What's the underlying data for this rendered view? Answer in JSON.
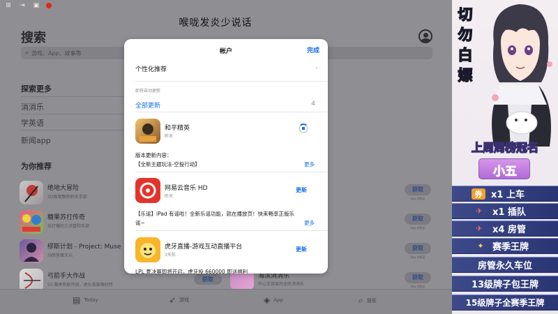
{
  "stream_title": "喉咙发炎少说话",
  "search_screen": {
    "title": "搜索",
    "search_placeholder": "游戏、App、故事等",
    "explore_heading": "探索更多",
    "explore_items": [
      "消消乐",
      "学英语",
      "新闻app"
    ],
    "recommend_heading": "为你推荐",
    "apps": [
      {
        "name": "绝地大冒险",
        "sub": "3D极限飘移射击手游",
        "button": "获取",
        "note": "App 内购买"
      },
      {
        "name": "糖果苏打传奇",
        "sub": "苏打糖的三消冒险手游",
        "button": "获取",
        "note": "App 内购买"
      },
      {
        "name": "缪斯计划 - Project: Muse",
        "sub": "动感音魔次元",
        "button": "获取",
        "note": "App 内购买"
      },
      {
        "name": "弓箭手大作战",
        "sub": "55 赛季新剧开放，虎头英雄限时特",
        "button": "获取",
        "note": "App 内购买"
      }
    ],
    "bg_get_button": "获取",
    "bg_app_2_name": "海滨消消乐",
    "bg_app_2_sub": "开心又容易的全民消消乐",
    "tabs": [
      "Today",
      "游戏",
      "App",
      "搜索"
    ]
  },
  "account_modal": {
    "title": "帐户",
    "done": "完成",
    "personalized": "个性化推荐",
    "auto_update_label": "即将自动更新",
    "update_all": "全部更新",
    "update_count": "4",
    "apps": [
      {
        "name": "和平精英",
        "date": "昨天",
        "notes_heading": "版本更新内容：",
        "notes": "【全新主题玩法-空投行动】",
        "more": "更多"
      },
      {
        "name": "网易云音乐 HD",
        "date": "昨天",
        "button": "更新",
        "notes": "【乐谣】iPad 有谣啦！全新乐谣功能，就在播放页！快来畅享正版乐",
        "notes_2": "谣~",
        "more": "更多"
      },
      {
        "name": "虎牙直播-游戏互动直播平台",
        "date": "3天前",
        "button": "更新",
        "notes": "LPL 夏决赛即将开启，虎牙投 660000 即送福利"
      }
    ]
  },
  "overlay": {
    "title_chars": [
      "切",
      "勿",
      "白",
      "嫖"
    ],
    "rank_banner": "上周周榜冠名",
    "rank_name": "小五",
    "perks": [
      {
        "icon": "coupon-icon",
        "glyph": "券",
        "text": "x1  上车"
      },
      {
        "icon": "plane-icon",
        "glyph": "✈",
        "text": "x1  插队"
      },
      {
        "icon": "plane-icon",
        "glyph": "✈",
        "text": "x4  房管"
      },
      {
        "icon": "medal-icon",
        "glyph": "✦",
        "text": "赛季王牌"
      },
      {
        "icon": "",
        "glyph": "",
        "text": "房管永久车位"
      },
      {
        "icon": "",
        "glyph": "",
        "text": "13级牌子包王牌"
      },
      {
        "icon": "",
        "glyph": "",
        "text": "15级牌子全赛季王牌"
      }
    ]
  },
  "colors": {
    "accent_blue": "#1570ef",
    "overlay_blue": "#2a3574",
    "record_red": "#e3261f"
  }
}
